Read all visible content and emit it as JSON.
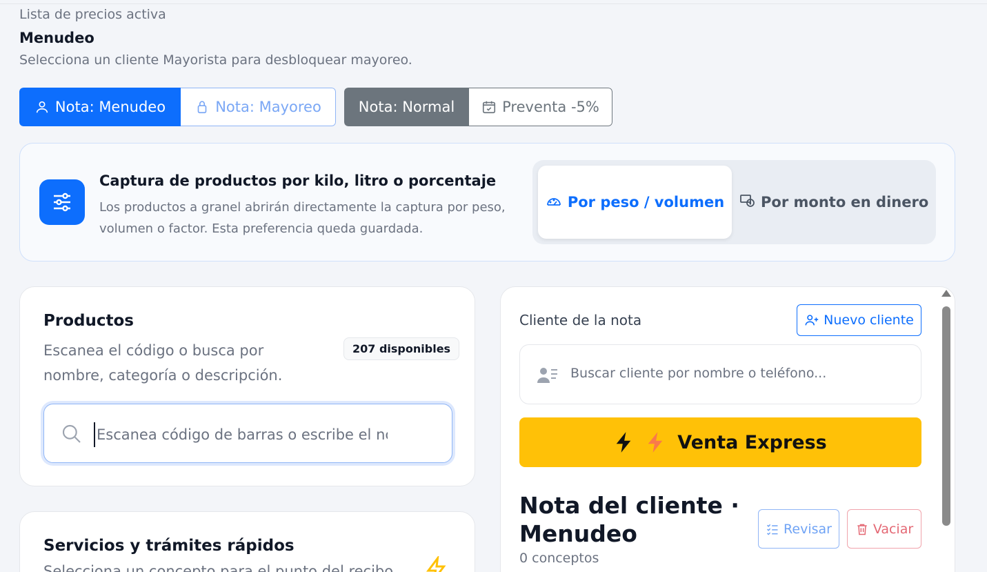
{
  "price_list": {
    "kicker": "Lista de precios activa",
    "title": "Menudeo",
    "hint": "Selecciona un cliente Mayorista para desbloquear mayoreo."
  },
  "price_buttons": {
    "menudeo": "Nota: Menudeo",
    "mayoreo": "Nota: Mayoreo",
    "normal": "Nota: Normal",
    "preventa": "Preventa -5%"
  },
  "capture": {
    "title": "Captura de productos por kilo, litro o porcentaje",
    "description": "Los productos a granel abrirán directamente la captura por peso, volumen o factor. Esta preferencia queda guardada.",
    "option_weight": "Por peso / volumen",
    "option_money": "Por monto en dinero"
  },
  "products": {
    "title": "Productos",
    "description": "Escanea el código o busca por nombre, categoría o descripción.",
    "badge": "207 disponibles",
    "search_placeholder": "Escanea código de barras o escribe el nc"
  },
  "services": {
    "title": "Servicios y trámites rápidos",
    "description": "Selecciona un concepto para el punto del recibo"
  },
  "client": {
    "label": "Cliente de la nota",
    "new_client": "Nuevo cliente",
    "search_placeholder": "Buscar cliente por nombre o teléfono...",
    "express": "Venta Express",
    "nota_title": "Nota del cliente · Menudeo",
    "nota_count": "0 conceptos",
    "revisar": "Revisar",
    "vaciar": "Vaciar"
  },
  "colors": {
    "primary": "#0d6efd",
    "secondary": "#6c757d",
    "warning": "#ffc107",
    "danger": "#dc3545"
  },
  "icons": {
    "menudeo": "person-icon",
    "mayoreo": "lock-icon",
    "preventa": "calendar-check-icon",
    "capture": "sliders-icon",
    "weight": "speedometer-icon",
    "money": "cash-coin-icon",
    "search": "search-icon",
    "new_client": "person-plus-icon",
    "client_search": "person-lines-icon",
    "express": "lightning-icon",
    "revisar": "list-check-icon",
    "vaciar": "trash-icon"
  }
}
